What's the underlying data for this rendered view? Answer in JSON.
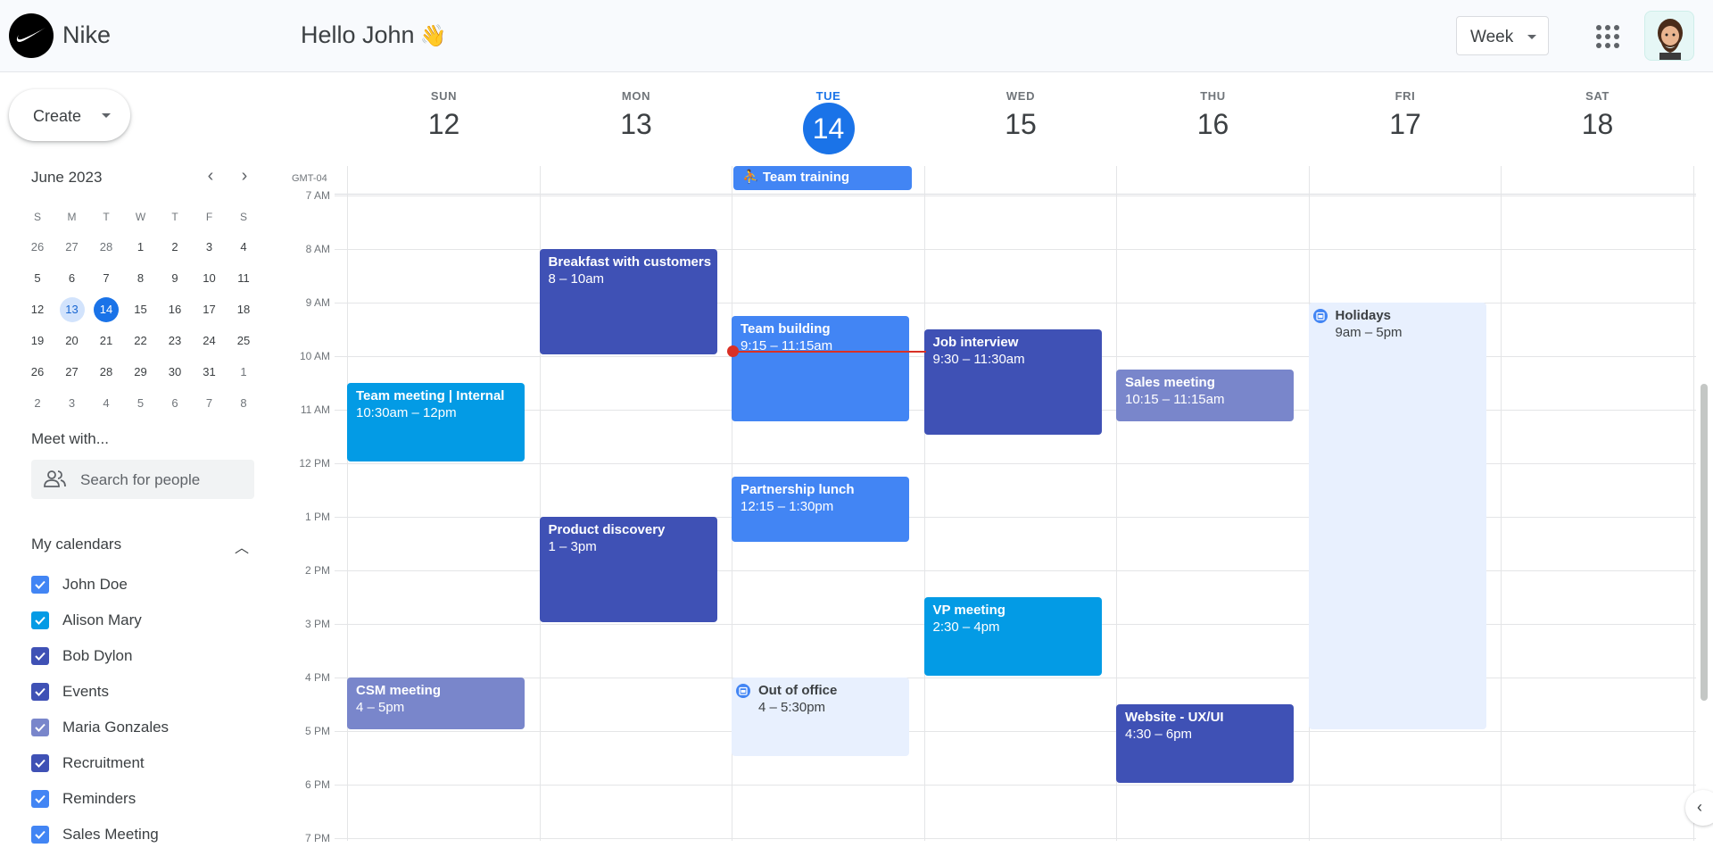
{
  "header": {
    "brand": "Nike",
    "greeting": "Hello John",
    "wave": "👋",
    "view_select": "Week"
  },
  "sidebar": {
    "create_label": "Create",
    "mini_calendar": {
      "title": "June 2023",
      "weekday_headers": [
        "S",
        "M",
        "T",
        "W",
        "T",
        "F",
        "S"
      ],
      "weeks": [
        [
          "26",
          "27",
          "28",
          "1",
          "2",
          "3",
          "4"
        ],
        [
          "5",
          "6",
          "7",
          "8",
          "9",
          "10",
          "11"
        ],
        [
          "12",
          "13",
          "14",
          "15",
          "16",
          "17",
          "18"
        ],
        [
          "19",
          "20",
          "21",
          "22",
          "23",
          "24",
          "25"
        ],
        [
          "26",
          "27",
          "28",
          "29",
          "30",
          "31",
          "1"
        ],
        [
          "2",
          "3",
          "4",
          "5",
          "6",
          "7",
          "8"
        ]
      ],
      "today": "14",
      "selected": "13"
    },
    "meet_with": "Meet with...",
    "search_placeholder": "Search for people",
    "my_calendars_title": "My calendars",
    "calendars": [
      {
        "name": "John Doe",
        "color": "#4285f4"
      },
      {
        "name": "Alison Mary",
        "color": "#039be5"
      },
      {
        "name": "Bob Dylon",
        "color": "#3f51b5"
      },
      {
        "name": "Events",
        "color": "#3f51b5"
      },
      {
        "name": "Maria Gonzales",
        "color": "#7986cb"
      },
      {
        "name": "Recruitment",
        "color": "#3f51b5"
      },
      {
        "name": "Reminders",
        "color": "#4285f4"
      },
      {
        "name": "Sales Meeting",
        "color": "#4285f4"
      }
    ]
  },
  "week": {
    "timezone": "GMT-04",
    "days": [
      {
        "name": "SUN",
        "date": "12"
      },
      {
        "name": "MON",
        "date": "13"
      },
      {
        "name": "TUE",
        "date": "14",
        "today": true
      },
      {
        "name": "WED",
        "date": "15"
      },
      {
        "name": "THU",
        "date": "16"
      },
      {
        "name": "FRI",
        "date": "17"
      },
      {
        "name": "SAT",
        "date": "18"
      }
    ],
    "hours": [
      "7 AM",
      "8 AM",
      "9 AM",
      "10 AM",
      "11 AM",
      "12 PM",
      "1 PM",
      "2 PM",
      "3 PM",
      "4 PM",
      "5 PM",
      "6 PM",
      "7 PM"
    ],
    "all_day_event": {
      "title": "Team training",
      "day": "TUE"
    },
    "events": [
      {
        "id": "breakfast",
        "title": "Breakfast with customers",
        "time": "8 – 10am",
        "day": "MON",
        "color": "#3f51b5"
      },
      {
        "id": "team-building",
        "title": "Team building",
        "time": "9:15 – 11:15am",
        "day": "TUE",
        "color": "#4285f4"
      },
      {
        "id": "job-interview",
        "title": "Job interview",
        "time": "9:30 – 11:30am",
        "day": "WED",
        "color": "#3f51b5"
      },
      {
        "id": "holidays",
        "title": "Holidays",
        "time": "9am – 5pm",
        "day": "FRI",
        "color": "#e8f0fe"
      },
      {
        "id": "team-meeting",
        "title": "Team meeting | Internal",
        "time": "10:30am – 12pm",
        "day": "SUN",
        "color": "#039be5"
      },
      {
        "id": "sales-meeting",
        "title": "Sales meeting",
        "time": "10:15 – 11:15am",
        "day": "THU",
        "color": "#7986cb"
      },
      {
        "id": "partnership-lunch",
        "title": "Partnership lunch",
        "time": "12:15 – 1:30pm",
        "day": "TUE",
        "color": "#4285f4"
      },
      {
        "id": "product-discovery",
        "title": "Product discovery",
        "time": "1 – 3pm",
        "day": "MON",
        "color": "#3f51b5"
      },
      {
        "id": "vp-meeting",
        "title": "VP meeting",
        "time": "2:30 – 4pm",
        "day": "WED",
        "color": "#039be5"
      },
      {
        "id": "csm-meeting",
        "title": "CSM meeting",
        "time": "4 – 5pm",
        "day": "SUN",
        "color": "#7986cb"
      },
      {
        "id": "out-of-office",
        "title": "Out of office",
        "time": "4 – 5:30pm",
        "day": "TUE",
        "color": "#e8f0fe"
      },
      {
        "id": "website",
        "title": "Website - UX/UI",
        "time": "4:30 – 6pm",
        "day": "THU",
        "color": "#3f51b5"
      }
    ]
  }
}
